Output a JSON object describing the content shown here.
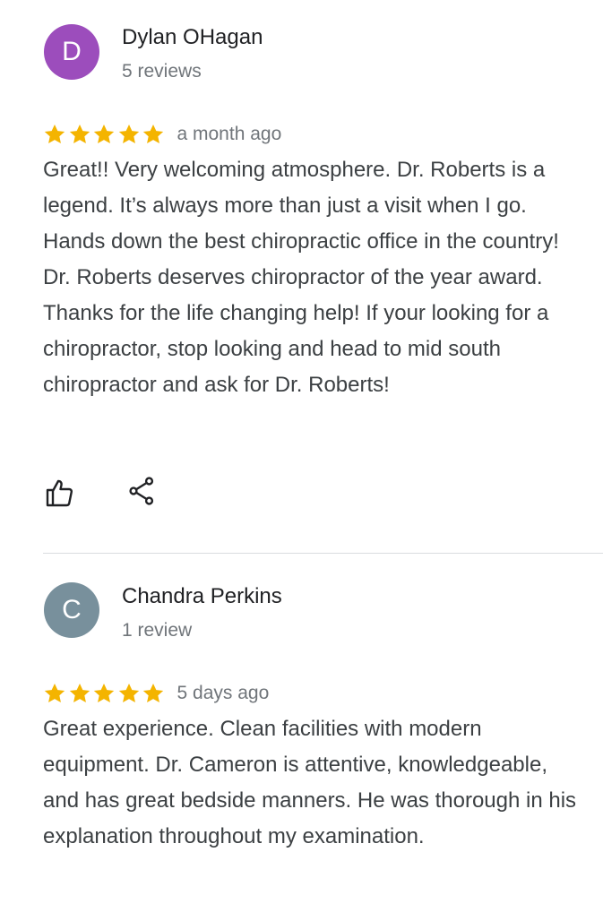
{
  "colors": {
    "star": "#f4b400",
    "avatar_dylan": "#9c4dbc",
    "avatar_chandra": "#78909c",
    "secondary_text": "#70757a",
    "body_text": "#3c4043"
  },
  "reviews": [
    {
      "avatar_letter": "D",
      "name": "Dylan OHagan",
      "review_count": "5 reviews",
      "rating": 5,
      "date": "a month ago",
      "text": "Great!! Very welcoming atmosphere. Dr. Roberts is a legend. It’s always more than just a visit when I go. Hands down the best chiropractic office in the country! Dr. Roberts deserves chiropractor of the year award. Thanks for the life changing help! If your looking for a chiropractor, stop looking and head to mid south chiropractor and ask for Dr. Roberts!",
      "actions": [
        "thumbs-up-icon",
        "share-icon"
      ]
    },
    {
      "avatar_letter": "C",
      "name": "Chandra Perkins",
      "review_count": "1 review",
      "rating": 5,
      "date": "5 days ago",
      "text": "Great experience. Clean facilities with modern equipment. Dr. Cameron is attentive, knowledgeable, and has great bedside manners. He was thorough in his explanation throughout my examination."
    }
  ]
}
